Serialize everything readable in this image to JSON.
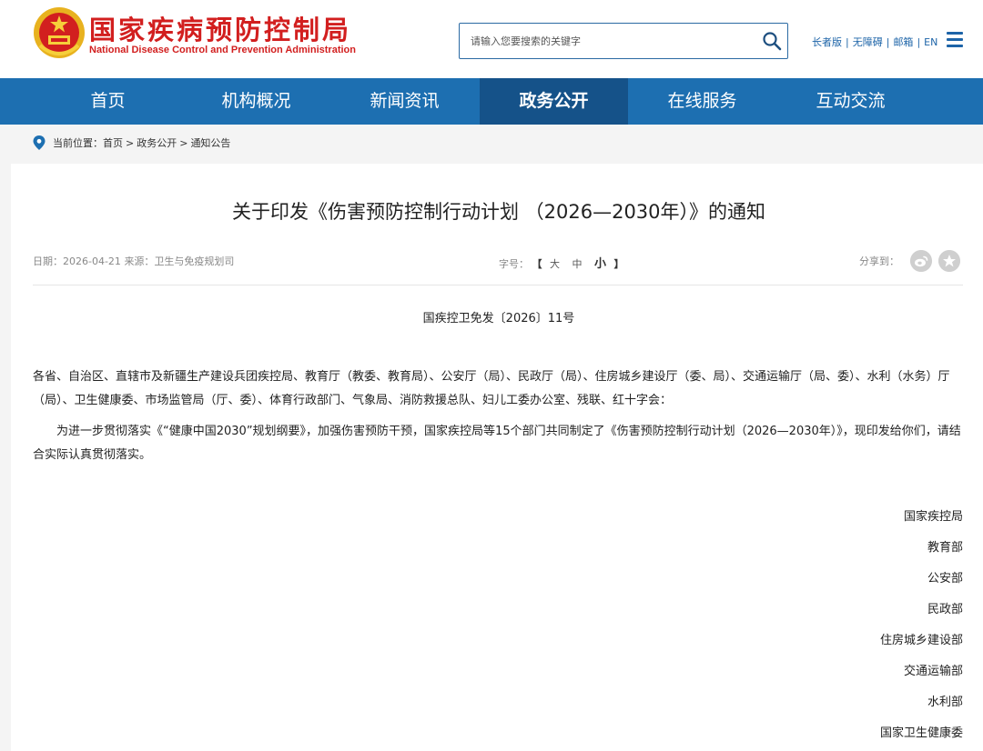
{
  "header": {
    "logo_cn": "国家疾病预防控制局",
    "logo_en": "National Disease Control and Prevention Administration",
    "search_placeholder": "请输入您要搜索的关键字",
    "links": [
      "长者版",
      "无障碍",
      "邮箱",
      "EN"
    ]
  },
  "nav": {
    "items": [
      {
        "label": "首页",
        "active": false
      },
      {
        "label": "机构概况",
        "active": false
      },
      {
        "label": "新闻资讯",
        "active": false
      },
      {
        "label": "政务公开",
        "active": true
      },
      {
        "label": "在线服务",
        "active": false
      },
      {
        "label": "互动交流",
        "active": false
      }
    ]
  },
  "breadcrumb": {
    "prefix": "当前位置：",
    "items": [
      "首页",
      "政务公开",
      "通知公告"
    ],
    "separator": ">"
  },
  "article": {
    "title": "关于印发《伤害预防控制行动计划 （2026—2030年）》的通知",
    "date_label": "日期：",
    "date": "2026-04-21",
    "source_label": "来源：",
    "source": "卫生与免疫规划司",
    "font_label": "字号：",
    "font_open": "【",
    "font_sizes": [
      "大",
      "中",
      "小"
    ],
    "font_close": "】",
    "share_label": "分享到：",
    "doc_number": "国疾控卫免发〔2026〕11号",
    "para1": "各省、自治区、直辖市及新疆生产建设兵团疾控局、教育厅（教委、教育局）、公安厅（局）、民政厅（局）、住房城乡建设厅（委、局）、交通运输厅（局、委）、水利（水务）厅（局）、卫生健康委、市场监管局（厅、委）、体育行政部门、气象局、消防救援总队、妇儿工委办公室、残联、红十字会：",
    "para2": "为进一步贯彻落实《“健康中国2030”规划纲要》，加强伤害预防干预，国家疾控局等15个部门共同制定了《伤害预防控制行动计划（2026—2030年）》，现印发给你们，请结合实际认真贯彻落实。",
    "signers": [
      "国家疾控局",
      "教育部",
      "公安部",
      "民政部",
      "住房城乡建设部",
      "交通运输部",
      "水利部",
      "国家卫生健康委"
    ]
  },
  "colors": {
    "brand_red": "#d21f1f",
    "nav_blue": "#1d6fb1",
    "nav_active": "#155289",
    "link_blue": "#1d64a8"
  }
}
